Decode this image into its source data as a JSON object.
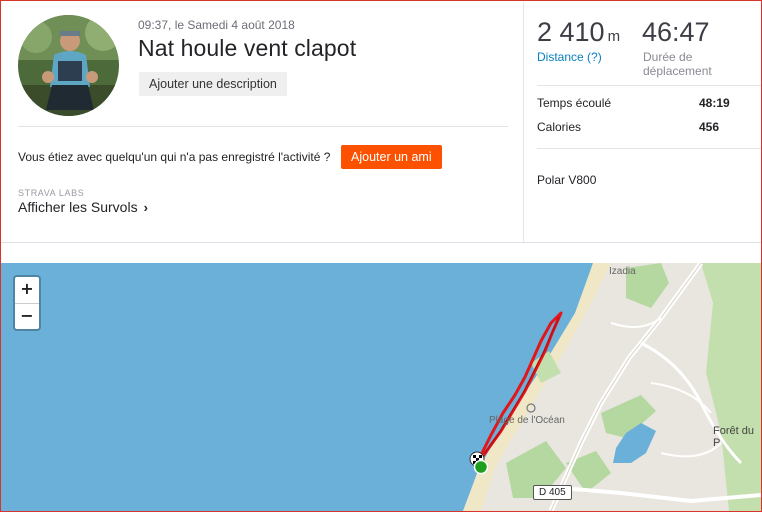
{
  "activity": {
    "datetime": "09:37, le Samedi 4 août 2018",
    "title": "Nat houle vent clapot",
    "add_description": "Ajouter une description"
  },
  "friend_prompt": {
    "text": "Vous étiez avec quelqu'un qui n'a pas enregistré l'activité ?",
    "button": "Ajouter un ami"
  },
  "labs": {
    "tag": "STRAVA LABS",
    "flyby": "Afficher les Survols"
  },
  "stats": {
    "distance_value": "2 410",
    "distance_unit": "m",
    "distance_label": "Distance (?)",
    "moving_time_value": "46:47",
    "moving_time_label_1": "Durée de",
    "moving_time_label_2": "déplacement",
    "rows": [
      {
        "label": "Temps écoulé",
        "value": "48:19"
      },
      {
        "label": "Calories",
        "value": "456"
      }
    ],
    "device": "Polar V800"
  },
  "map": {
    "zoom_in": "+",
    "zoom_out": "−",
    "labels": {
      "izadia": "Izadia",
      "plage": "Plage de l'Océan",
      "foret": "Forêt du P",
      "road": "D 405"
    },
    "colors": {
      "sea": "#6ab0d8",
      "land": "#e8e6df",
      "sand": "#efe7c6",
      "green": "#b5d8a0",
      "route": "#e3161c",
      "start": "#1ea01e"
    }
  },
  "icons": {
    "chevron": "chevron-right-icon",
    "start": "start-marker-icon",
    "finish": "finish-flag-icon"
  }
}
